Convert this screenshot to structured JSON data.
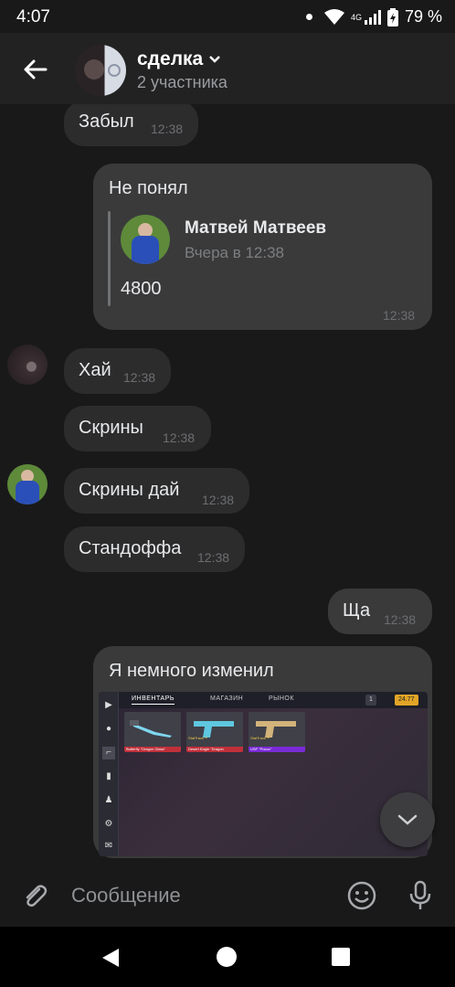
{
  "status_bar": {
    "time": "4:07",
    "network": "4G",
    "battery": "79 %"
  },
  "header": {
    "title": "сделка",
    "subtitle": "2 участника"
  },
  "messages": [
    {
      "text": "Забыл",
      "time": "12:38",
      "direction": "in"
    },
    {
      "text": "Не понял",
      "time": "12:38",
      "direction": "out",
      "reply": {
        "author": "Матвей Матвеев",
        "date": "Вчера в 12:38",
        "text": "4800"
      }
    },
    {
      "text": "Хай",
      "time": "12:38",
      "direction": "in"
    },
    {
      "text": "Скрины",
      "time": "12:38",
      "direction": "in"
    },
    {
      "text": "Скрины дай",
      "time": "12:38",
      "direction": "in"
    },
    {
      "text": "Стандоффа",
      "time": "12:38",
      "direction": "in"
    },
    {
      "text": "Ща",
      "time": "12:38",
      "direction": "out"
    },
    {
      "text": "Я немного изменил",
      "direction": "out",
      "screenshot": {
        "tabs": [
          "ИНВЕНТАРЬ",
          "МАГАЗИН",
          "РЫНОК"
        ],
        "balance_silver": "1",
        "balance_gold": "24.77",
        "items": [
          {
            "name": "Butterfly \"Dragon Glass\"",
            "rarity_color": "#c0303a"
          },
          {
            "name": "Desert Eagle \"Dragon",
            "tag": "StatTrack™",
            "rarity_color": "#c0303a"
          },
          {
            "name": "USP \"Pисос\"",
            "tag": "StatTrack™",
            "rarity_color": "#7a2bd6"
          }
        ]
      }
    }
  ],
  "composer": {
    "placeholder": "Сообщение"
  },
  "icons": {
    "back": "arrow-left-icon",
    "dropdown": "chevron-down-icon",
    "attach": "paperclip-icon",
    "emoji": "smiley-icon",
    "mic": "microphone-icon",
    "scroll": "chevron-down-icon"
  },
  "colors": {
    "background": "#19191a",
    "bubble_in": "#2c2c2d",
    "bubble_out": "#3a3a3b",
    "accent": "#ffffff"
  }
}
